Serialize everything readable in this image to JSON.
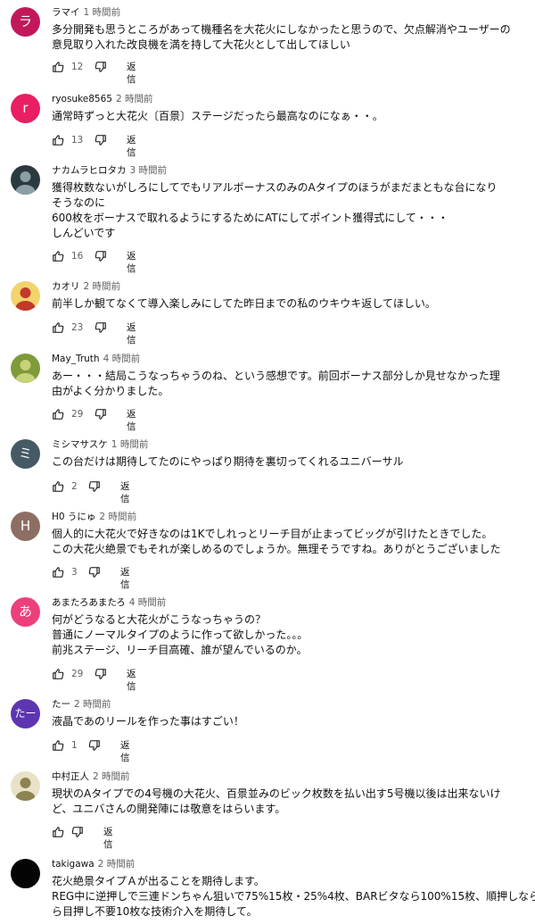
{
  "comments": [
    {
      "author": "ラマイ",
      "time": "1 時間前",
      "avatar": {
        "type": "letter",
        "letter": "ラ",
        "color": "#c2185b"
      },
      "lines": [
        "多分開発も思うところがあって機種名を大花火にしなかったと思うので、欠点解消やユーザーの",
        "意見取り入れた改良機を満を持して大花火として出してほしい"
      ],
      "likes": "12",
      "reply": "返信"
    },
    {
      "author": "ryosuke8565",
      "time": "2 時間前",
      "avatar": {
        "type": "letter",
        "letter": "r",
        "color": "#e91e63"
      },
      "lines": [
        "通常時ずっと大花火〔百景〕ステージだったら最高なのになぁ・・。"
      ],
      "likes": "13",
      "reply": "返信"
    },
    {
      "author": "ナカムラヒロタカ",
      "time": "3 時間前",
      "avatar": {
        "type": "photo",
        "bg": "#2b3a3f",
        "fg": "#8aa0a6"
      },
      "lines": [
        "獲得枚数ないがしろにしてでもリアルボーナスのみのAタイプのほうがまだまともな台になり",
        "そうなのに",
        "600枚をボーナスで取れるようにするためにATにしてポイント獲得式にして・・・",
        "しんどいです"
      ],
      "likes": "16",
      "reply": "返信"
    },
    {
      "author": "カオリ",
      "time": "2 時間前",
      "avatar": {
        "type": "photo",
        "bg": "#f3d36b",
        "fg": "#c0392b"
      },
      "lines": [
        "前半しか観てなくて導入楽しみにしてた昨日までの私のウキウキ返してほしい。"
      ],
      "likes": "23",
      "reply": "返信"
    },
    {
      "author": "May_Truth",
      "time": "4 時間前",
      "avatar": {
        "type": "photo",
        "bg": "#7f9a3a",
        "fg": "#c9d27a"
      },
      "lines": [
        "あー・・・結局こうなっちゃうのね、という感想です。前回ボーナス部分しか見せなかった理",
        "由がよく分かりました。"
      ],
      "likes": "29",
      "reply": "返信"
    },
    {
      "author": "ミシマサスケ",
      "time": "1 時間前",
      "avatar": {
        "type": "letter",
        "letter": "ミ",
        "color": "#455a64"
      },
      "lines": [
        "この台だけは期待してたのにやっぱり期待を裏切ってくれるユニバーサル"
      ],
      "likes": "2",
      "reply": "返信"
    },
    {
      "author": "H0 うにゅ",
      "time": "2 時間前",
      "avatar": {
        "type": "letter",
        "letter": "H",
        "color": "#8d6e63"
      },
      "lines": [
        "個人的に大花火で好きなのは1Kでしれっとリーチ目が止まってビッグが引けたときでした。",
        "この大花火絶景でもそれが楽しめるのでしょうか。無理そうですね。ありがとうございました"
      ],
      "likes": "3",
      "reply": "返信"
    },
    {
      "author": "あまたろあまたろ",
      "time": "4 時間前",
      "avatar": {
        "type": "letter",
        "letter": "あ",
        "color": "#ec407a"
      },
      "lines": [
        "何がどうなると大花火がこうなっちゃうの？",
        "普通にノーマルタイプのように作って欲しかった。。。",
        "前兆ステージ、リーチ目高確、誰が望んでいるのか。"
      ],
      "likes": "29",
      "reply": "返信"
    },
    {
      "author": "たー",
      "time": "2 時間前",
      "avatar": {
        "type": "letter",
        "letter": "たー",
        "color": "#5e35b1"
      },
      "lines": [
        "液晶であのリールを作った事はすごい！"
      ],
      "likes": "1",
      "reply": "返信"
    },
    {
      "author": "中村正人",
      "time": "2 時間前",
      "avatar": {
        "type": "photo",
        "bg": "#e8e2c8",
        "fg": "#8c8350"
      },
      "lines": [
        "現状のAタイプでの4号機の大花火、百景並みのビック枚数を払い出す5号機以後は出来ないけ",
        "ど、ユニバさんの開発陣には敬意をはらいます。"
      ],
      "likes": "",
      "reply": "返信"
    },
    {
      "author": "takigawa",
      "time": "2 時間前",
      "avatar": {
        "type": "photo",
        "bg": "#050505",
        "fg": "#050505"
      },
      "lines": [
        "花火絶景タイプＡが出ることを期待します。",
        "REG中に逆押しで三連ドンちゃん狙いで75%15枚・25%4枚、BARビタなら100%15枚、順押しなら",
        "ら目押し不要10枚な技術介入を期待して。"
      ],
      "likes": "",
      "reply": ""
    }
  ]
}
